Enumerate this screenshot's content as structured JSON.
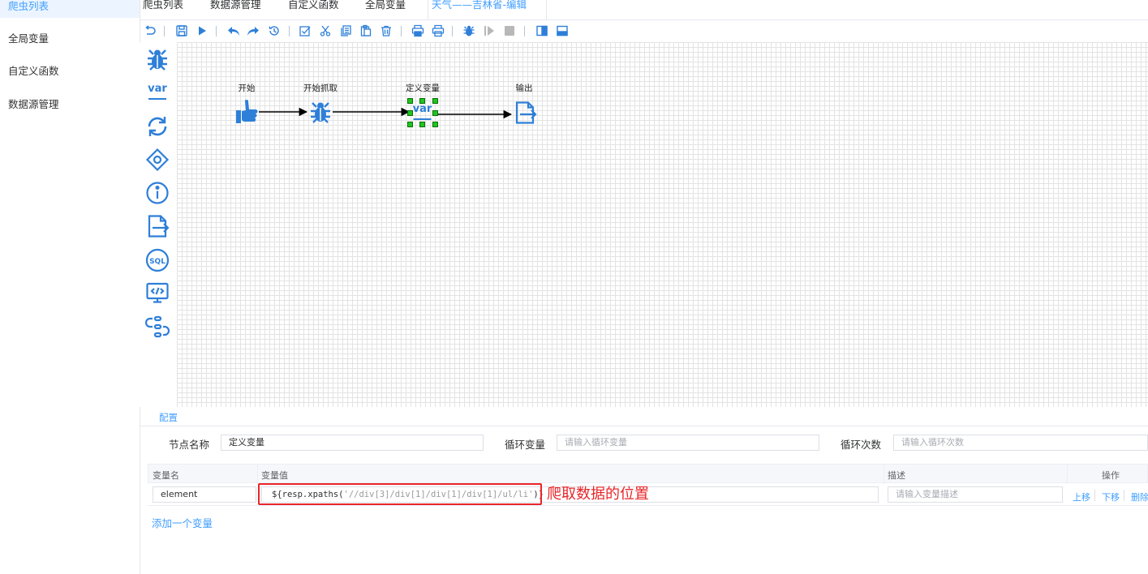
{
  "sidebar": {
    "items": [
      {
        "label": "爬虫列表",
        "active": true
      },
      {
        "label": "全局变量",
        "active": false
      },
      {
        "label": "自定义函数",
        "active": false
      },
      {
        "label": "数据源管理",
        "active": false
      }
    ]
  },
  "tabs": [
    {
      "label": "爬虫列表",
      "active": false
    },
    {
      "label": "数据源管理",
      "active": false
    },
    {
      "label": "自定义函数",
      "active": false
    },
    {
      "label": "全局变量",
      "active": false
    },
    {
      "label": "天气——吉林省-编辑",
      "active": true
    }
  ],
  "toolbar": {
    "buttons": [
      "undo-icon",
      "save-icon",
      "run-icon",
      "undo-arrow-icon",
      "redo-arrow-icon",
      "history-icon",
      "select-all-icon",
      "cut-icon",
      "copy-icon",
      "paste-icon",
      "delete-icon",
      "print-preview-icon",
      "print-icon",
      "debug-icon",
      "resume-icon",
      "stop-icon",
      "right-panel-icon",
      "bottom-panel-icon"
    ]
  },
  "palette": {
    "items": [
      "spider-icon",
      "variable-icon",
      "loop-icon",
      "condition-icon",
      "info-icon",
      "output-icon",
      "sql-icon",
      "code-icon",
      "function-icon"
    ]
  },
  "flow": {
    "nodes": [
      {
        "label": "开始",
        "icon": "hand-pointer-icon"
      },
      {
        "label": "开始抓取",
        "icon": "spider-icon"
      },
      {
        "label": "定义变量",
        "icon": "variable-icon",
        "selected": true
      },
      {
        "label": "输出",
        "icon": "output-icon"
      }
    ]
  },
  "config": {
    "tab_label": "配置",
    "node_name_label": "节点名称",
    "node_name_value": "定义变量",
    "loop_var_label": "循环变量",
    "loop_var_placeholder": "请输入循环变量",
    "loop_count_label": "循环次数",
    "loop_count_placeholder": "请输入循环次数"
  },
  "var_table": {
    "headers": {
      "name": "变量名",
      "value": "变量值",
      "desc": "描述",
      "ops": "操作"
    },
    "rows": [
      {
        "name": "element",
        "value_prefix": "${resp.xpaths(",
        "value_arg": "'//div[3]/div[1]/div[1]/div[1]/ul/li'",
        "value_suffix": ")}",
        "desc_placeholder": "请输入变量描述",
        "ops": [
          "上移",
          "下移",
          "删除"
        ]
      }
    ],
    "add_label": "添加一个变量"
  },
  "annotation": "爬取数据的位置",
  "colors": {
    "accent": "#409eff",
    "icon": "#2e7fd8",
    "highlight": "#e8262a",
    "handle": "#1fc41f"
  }
}
